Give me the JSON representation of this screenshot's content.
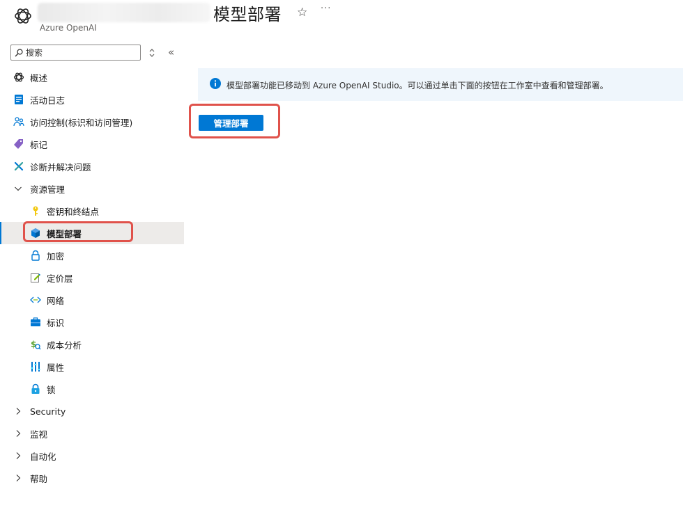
{
  "header": {
    "title": "模型部署",
    "subtitle": "Azure OpenAI"
  },
  "search": {
    "placeholder": "搜索"
  },
  "sidebar": {
    "items": [
      {
        "label": "概述",
        "icon": "openai-icon"
      },
      {
        "label": "活动日志",
        "icon": "activity-log-icon"
      },
      {
        "label": "访问控制(标识和访问管理)",
        "icon": "people-icon"
      },
      {
        "label": "标记",
        "icon": "tag-icon"
      },
      {
        "label": "诊断并解决问题",
        "icon": "wrench-icon"
      },
      {
        "label": "资源管理",
        "icon": "chevron-down-icon",
        "expanded": true
      },
      {
        "label": "密钥和终结点",
        "icon": "key-icon"
      },
      {
        "label": "模型部署",
        "icon": "cube-icon",
        "selected": true
      },
      {
        "label": "加密",
        "icon": "lock-icon"
      },
      {
        "label": "定价层",
        "icon": "edit-icon"
      },
      {
        "label": "网络",
        "icon": "network-icon"
      },
      {
        "label": "标识",
        "icon": "identity-icon"
      },
      {
        "label": "成本分析",
        "icon": "cost-icon"
      },
      {
        "label": "属性",
        "icon": "properties-icon"
      },
      {
        "label": "锁",
        "icon": "padlock-icon"
      },
      {
        "label": "Security",
        "icon": "chevron-right-icon"
      },
      {
        "label": "监视",
        "icon": "chevron-right-icon"
      },
      {
        "label": "自动化",
        "icon": "chevron-right-icon"
      },
      {
        "label": "帮助",
        "icon": "chevron-right-icon"
      }
    ]
  },
  "main": {
    "info_text": "模型部署功能已移动到 Azure OpenAI Studio。可以通过单击下面的按钮在工作室中查看和管理部署。",
    "manage_button": "管理部署"
  },
  "colors": {
    "accent": "#0078d4",
    "info_background": "#eff6fc",
    "highlight": "#e0524b",
    "selected_background": "#edebe9"
  }
}
